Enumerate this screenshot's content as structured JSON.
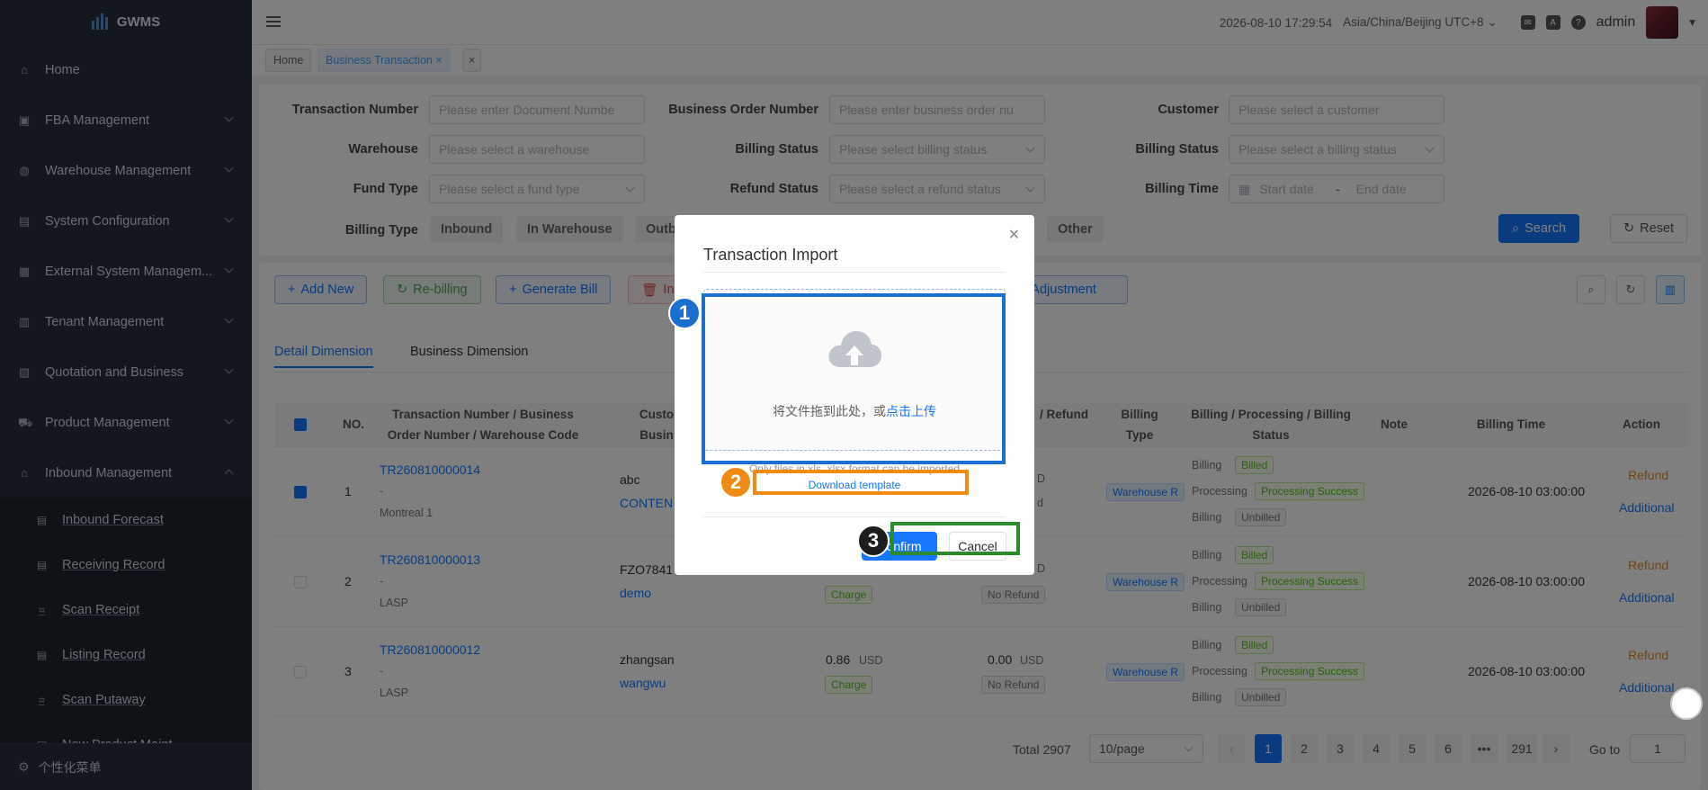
{
  "app": {
    "name": "GWMS"
  },
  "sidebar": {
    "items": [
      {
        "label": "Home",
        "icon": "home-icon",
        "expandable": false
      },
      {
        "label": "FBA Management",
        "icon": "box-icon",
        "expandable": true
      },
      {
        "label": "Warehouse Management",
        "icon": "globe-icon",
        "expandable": true
      },
      {
        "label": "System Configuration",
        "icon": "config-icon",
        "expandable": true
      },
      {
        "label": "External System Managem...",
        "icon": "grid-icon",
        "expandable": true
      },
      {
        "label": "Tenant Management",
        "icon": "bar-chart-icon",
        "expandable": true
      },
      {
        "label": "Quotation and Business",
        "icon": "document-icon",
        "expandable": true
      },
      {
        "label": "Product Management",
        "icon": "cart-icon",
        "expandable": true
      },
      {
        "label": "Inbound Management",
        "icon": "inbox-icon",
        "expandable": true,
        "expanded": true
      }
    ],
    "subitems": [
      {
        "label": "Inbound Forecast",
        "icon": "document-icon"
      },
      {
        "label": "Receiving Record",
        "icon": "document-icon"
      },
      {
        "label": "Scan Receipt",
        "icon": "scan-icon"
      },
      {
        "label": "Listing Record",
        "icon": "document-icon"
      },
      {
        "label": "Scan Putaway",
        "icon": "scan-icon"
      },
      {
        "label": "New Product Maint...",
        "icon": "document-icon"
      }
    ],
    "footer": "个性化菜单"
  },
  "topbar": {
    "datetime": "2026-08-10 17:29:54",
    "timezone": "Asia/China/Beijing UTC+8",
    "user": "admin"
  },
  "tabs": [
    {
      "label": "Home",
      "active": false
    },
    {
      "label": "Business Transaction",
      "active": true
    }
  ],
  "filters": {
    "transaction_number": {
      "label": "Transaction Number",
      "placeholder": "Please enter Document Numbe"
    },
    "business_order_number": {
      "label": "Business Order Number",
      "placeholder": "Please enter business order nu"
    },
    "customer": {
      "label": "Customer",
      "placeholder": "Please select a customer"
    },
    "warehouse": {
      "label": "Warehouse",
      "placeholder": "Please select a warehouse"
    },
    "billing_status_1": {
      "label": "Billing Status",
      "placeholder": "Please select billing status"
    },
    "billing_status_2": {
      "label": "Billing Status",
      "placeholder": "Please select a billing status"
    },
    "fund_type": {
      "label": "Fund Type",
      "placeholder": "Please select a fund type"
    },
    "refund_status": {
      "label": "Refund Status",
      "placeholder": "Please select a refund status"
    },
    "billing_time": {
      "label": "Billing Time",
      "start": "Start date",
      "sep": "-",
      "end": "End date"
    },
    "billing_type": {
      "label": "Billing Type",
      "options": [
        "Inbound",
        "In Warehouse",
        "Outb",
        "Other"
      ]
    },
    "search": "Search",
    "reset": "Reset"
  },
  "toolbar": {
    "add_new": "Add New",
    "rebilling": "Re-billing",
    "generate_bill": "Generate Bill",
    "invalidate": "In",
    "adjustment": "e Adjustment"
  },
  "detail_tabs": [
    "Detail Dimension",
    "Business Dimension"
  ],
  "table": {
    "headers": {
      "no": "NO.",
      "txn": "Transaction Number / Business Order Number / Warehouse Code",
      "cust": "Custo Busin",
      "refund": "/ Refund",
      "billing_type": "Billing Type",
      "bps": "Billing / Processing / Billing Status",
      "note": "Note",
      "billing_time": "Billing Time",
      "action": "Action"
    },
    "rows": [
      {
        "no": "1",
        "txn": "TR260810000014",
        "order": "-",
        "wh": "Montreal 1",
        "cust1": "abc",
        "cust2": "CONTEN",
        "amount": "",
        "currency": "",
        "fund": "",
        "refund": "",
        "refund_cur": "D",
        "refund_badge": "d",
        "type": "Warehouse R",
        "billing": "Billed",
        "processing": "Processing Success",
        "billing2": "Unbilled",
        "time": "2026-08-10 03:00:00",
        "action1": "Refund",
        "action2": "Additional",
        "checked": true
      },
      {
        "no": "2",
        "txn": "TR260810000013",
        "order": "-",
        "wh": "LASP",
        "cust1": "FZO7841",
        "cust2": "demo",
        "amount": "",
        "currency": "",
        "fund": "Charge",
        "refund": "",
        "refund_cur": "D",
        "refund_badge": "No Refund",
        "type": "Warehouse R",
        "billing": "Billed",
        "processing": "Processing Success",
        "billing2": "Unbilled",
        "time": "2026-08-10 03:00:00",
        "action1": "Refund",
        "action2": "Additional",
        "checked": false
      },
      {
        "no": "3",
        "txn": "TR260810000012",
        "order": "-",
        "wh": "LASP",
        "cust1": "zhangsan",
        "cust2": "wangwu",
        "amount": "0.86",
        "currency": "USD",
        "fund": "Charge",
        "refund": "0.00",
        "refund_cur": "USD",
        "refund_badge": "No Refund",
        "type": "Warehouse R",
        "billing": "Billed",
        "processing": "Processing Success",
        "billing2": "Unbilled",
        "time": "2026-08-10 03:00:00",
        "action1": "Refund",
        "action2": "Additional",
        "checked": false
      }
    ],
    "row_labels": {
      "billing": "Billing",
      "processing": "Processing"
    }
  },
  "pagination": {
    "total": "Total 2907",
    "page_size": "10/page",
    "pages": [
      "1",
      "2",
      "3",
      "4",
      "5",
      "6",
      "•••",
      "291"
    ],
    "current": "1",
    "goto_label": "Go to",
    "goto_value": "1"
  },
  "modal": {
    "title": "Transaction Import",
    "drop_text": "将文件拖到此处，或",
    "upload_link": "点击上传",
    "tip": "Only files in xls, xlsx format can be imported",
    "download": "Download template",
    "confirm": "Confirm",
    "cancel": "Cancel"
  },
  "annotations": [
    {
      "number": "1",
      "color": "#1a6fd0"
    },
    {
      "number": "2",
      "color": "#f08a12"
    },
    {
      "number": "3",
      "color": "#2c8a2c"
    }
  ]
}
